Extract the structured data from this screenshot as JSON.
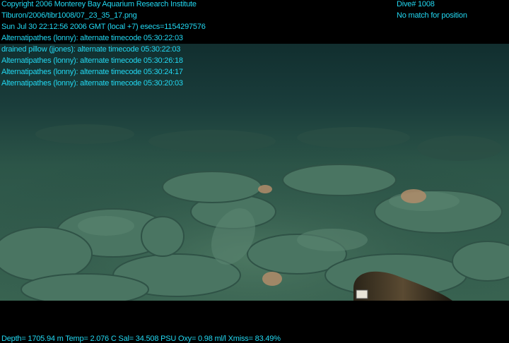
{
  "header": {
    "copyright": "Copyright 2006 Monterey Bay Aquarium Research Institute",
    "file_path": "Tiburon/2006/tibr1008/07_23_35_17.png",
    "timestamp": "Sun Jul 30 22:12:56 2006 GMT (local +7)  esecs=1154297576",
    "dive_number": "Dive# 1008",
    "position_status": "No match for position"
  },
  "annotations": [
    "Alternatipathes (lonny): alternate timecode 05:30:22:03",
    "drained pillow (jjones): alternate timecode 05:30:22:03",
    "Alternatipathes (lonny): alternate timecode 05:30:26:18",
    "Alternatipathes (lonny): alternate timecode 05:30:24:17",
    "Alternatipathes (lonny): alternate timecode 05:30:20:03"
  ],
  "telemetry": "Depth= 1705.94 m  Temp= 2.076 C  Sal= 34.508 PSU  Oxy= 0.98 ml/l  Xmiss= 83.49%",
  "colors": {
    "overlay_text": "#22d8f2",
    "water_top": "#0f2a2c",
    "seafloor": "#3f6a5a"
  }
}
